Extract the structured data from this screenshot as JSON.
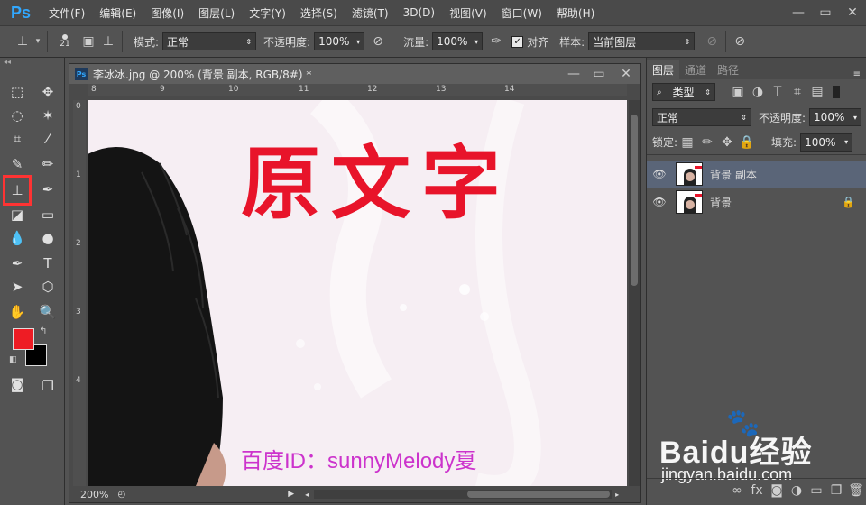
{
  "app": {
    "logo": "Ps"
  },
  "menu": [
    "文件(F)",
    "编辑(E)",
    "图像(I)",
    "图层(L)",
    "文字(Y)",
    "选择(S)",
    "滤镜(T)",
    "3D(D)",
    "视图(V)",
    "窗口(W)",
    "帮助(H)"
  ],
  "options": {
    "brush_size": "21",
    "mode_label": "模式:",
    "mode_value": "正常",
    "opacity_label": "不透明度:",
    "opacity_value": "100%",
    "flow_label": "流量:",
    "flow_value": "100%",
    "align_label": "对齐",
    "sample_label": "样本:",
    "sample_value": "当前图层"
  },
  "document": {
    "title": "李冰冰.jpg @ 200% (背景 副本, RGB/8#) *",
    "zoom": "200%",
    "ruler_h": [
      "8",
      "9",
      "10",
      "11",
      "12",
      "13",
      "14"
    ],
    "ruler_v": [
      "0",
      "1",
      "2",
      "3",
      "4"
    ],
    "image_text": "原文字",
    "watermark": "百度ID：sunnyMelody夏"
  },
  "layers_panel": {
    "tabs": [
      "图层",
      "通道",
      "路径"
    ],
    "filter_label": "类型",
    "blend_mode": "正常",
    "opacity_label": "不透明度:",
    "opacity_value": "100%",
    "lock_label": "锁定:",
    "fill_label": "填充:",
    "fill_value": "100%",
    "layers": [
      {
        "name": "背景 副本",
        "selected": true,
        "locked": false
      },
      {
        "name": "背景",
        "selected": false,
        "locked": true
      }
    ]
  },
  "brand_watermark": {
    "logo_text": "Baidu经验",
    "url": "jingyan.baidu.com"
  },
  "colors": {
    "foreground": "#ee1c24",
    "background": "#000000",
    "accent_selected": "#5a6578",
    "highlight": "#ff3333"
  }
}
